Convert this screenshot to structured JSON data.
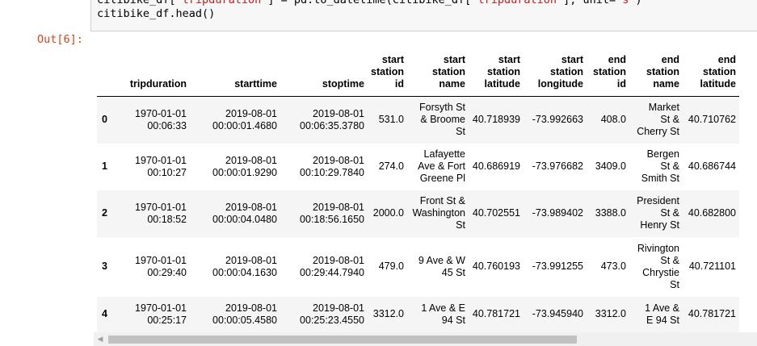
{
  "code": {
    "line1_prefix": "citibike_df[",
    "line1_str1": "'tripduration'",
    "line1_mid": "] = pd.to_datetime(citibike_df[",
    "line1_str2": "'tripduration'",
    "line1_mid2": "], unit=",
    "line1_str3": "'s'",
    "line1_end": ")",
    "line2": "citibike_df.head()"
  },
  "prompt": "Out[6]:",
  "table": {
    "columns": [
      [
        "tripduration"
      ],
      [
        "starttime"
      ],
      [
        "stoptime"
      ],
      [
        "start",
        "station",
        "id"
      ],
      [
        "start",
        "station",
        "name"
      ],
      [
        "start",
        "station",
        "latitude"
      ],
      [
        "start",
        "station",
        "longitude"
      ],
      [
        "end",
        "station",
        "id"
      ],
      [
        "end",
        "station",
        "name"
      ],
      [
        "end",
        "station",
        "latitude"
      ]
    ],
    "rows": [
      {
        "index": "0",
        "cells": [
          [
            "1970-01-01",
            "00:06:33"
          ],
          [
            "2019-08-01",
            "00:00:01.4680"
          ],
          [
            "2019-08-01",
            "00:06:35.3780"
          ],
          [
            "531.0"
          ],
          [
            "Forsyth St",
            "& Broome",
            "St"
          ],
          [
            "40.718939"
          ],
          [
            "-73.992663"
          ],
          [
            "408.0"
          ],
          [
            "Market",
            "St &",
            "Cherry St"
          ],
          [
            "40.710762"
          ]
        ]
      },
      {
        "index": "1",
        "cells": [
          [
            "1970-01-01",
            "00:10:27"
          ],
          [
            "2019-08-01",
            "00:00:01.9290"
          ],
          [
            "2019-08-01",
            "00:10:29.7840"
          ],
          [
            "274.0"
          ],
          [
            "Lafayette",
            "Ave & Fort",
            "Greene Pl"
          ],
          [
            "40.686919"
          ],
          [
            "-73.976682"
          ],
          [
            "3409.0"
          ],
          [
            "Bergen",
            "St &",
            "Smith St"
          ],
          [
            "40.686744"
          ]
        ]
      },
      {
        "index": "2",
        "cells": [
          [
            "1970-01-01",
            "00:18:52"
          ],
          [
            "2019-08-01",
            "00:00:04.0480"
          ],
          [
            "2019-08-01",
            "00:18:56.1650"
          ],
          [
            "2000.0"
          ],
          [
            "Front St &",
            "Washington",
            "St"
          ],
          [
            "40.702551"
          ],
          [
            "-73.989402"
          ],
          [
            "3388.0"
          ],
          [
            "President",
            "St &",
            "Henry St"
          ],
          [
            "40.682800"
          ]
        ]
      },
      {
        "index": "3",
        "cells": [
          [
            "1970-01-01",
            "00:29:40"
          ],
          [
            "2019-08-01",
            "00:00:04.1630"
          ],
          [
            "2019-08-01",
            "00:29:44.7940"
          ],
          [
            "479.0"
          ],
          [
            "9 Ave & W",
            "45 St"
          ],
          [
            "40.760193"
          ],
          [
            "-73.991255"
          ],
          [
            "473.0"
          ],
          [
            "Rivington",
            "St &",
            "Chrystie",
            "St"
          ],
          [
            "40.721101"
          ]
        ]
      },
      {
        "index": "4",
        "cells": [
          [
            "1970-01-01",
            "00:25:17"
          ],
          [
            "2019-08-01",
            "00:00:05.4580"
          ],
          [
            "2019-08-01",
            "00:25:23.4550"
          ],
          [
            "3312.0"
          ],
          [
            "1 Ave & E",
            "94 St"
          ],
          [
            "40.781721"
          ],
          [
            "-73.945940"
          ],
          [
            "3312.0"
          ],
          [
            "1 Ave &",
            "E 94 St"
          ],
          [
            "40.781721"
          ]
        ]
      }
    ]
  },
  "scrollbar": {
    "left_arrow": "◀"
  }
}
